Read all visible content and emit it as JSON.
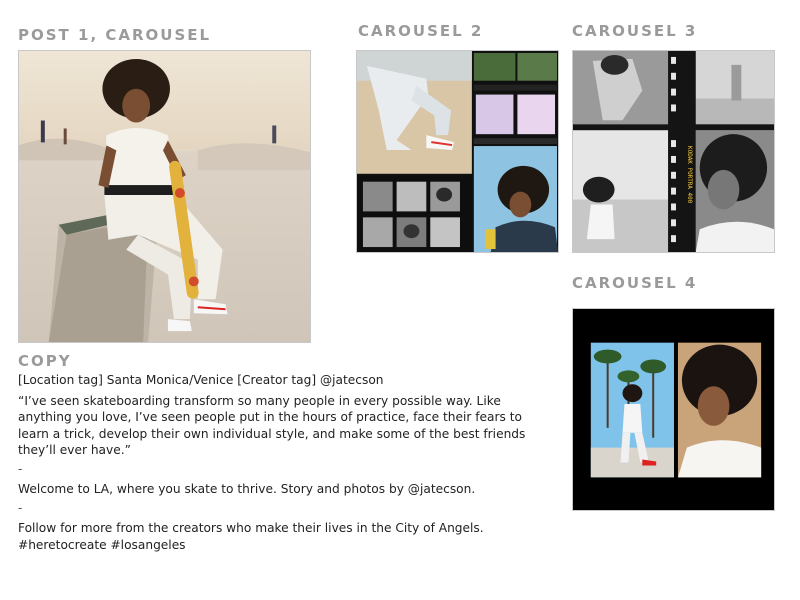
{
  "headings": {
    "post1": "POST 1, CAROUSEL",
    "carousel2": "CAROUSEL 2",
    "carousel3": "CAROUSEL 3",
    "carousel4": "CAROUSEL 4",
    "copy": "COPY"
  },
  "film_text": {
    "brand": "KODAK PORTRA 400"
  },
  "copy": {
    "tags": "[Location tag] Santa Monica/Venice [Creator tag] @jatecson",
    "quote": "“I’ve seen skateboarding transform so many people in every possible way. Like anything you love, I’ve seen people put in the hours of practice, face their fears to learn a trick, develop their own individual style, and make some of the best friends they’ll ever have.”",
    "separator_1": "-",
    "welcome": "Welcome to LA, where you skate to thrive. Story and photos by @jatecson.",
    "separator_2": "-",
    "follow": "Follow for more from the creators who make their lives in the City of Angels.",
    "hashtags": "#heretocreate #losangeles"
  },
  "colors": {
    "heading_gray": "#9a9a9a",
    "text": "#222222",
    "sky": "#e9dcc8",
    "concrete": "#d8cfc2",
    "film_black": "#101010",
    "skateboard": "#e3b23c"
  }
}
